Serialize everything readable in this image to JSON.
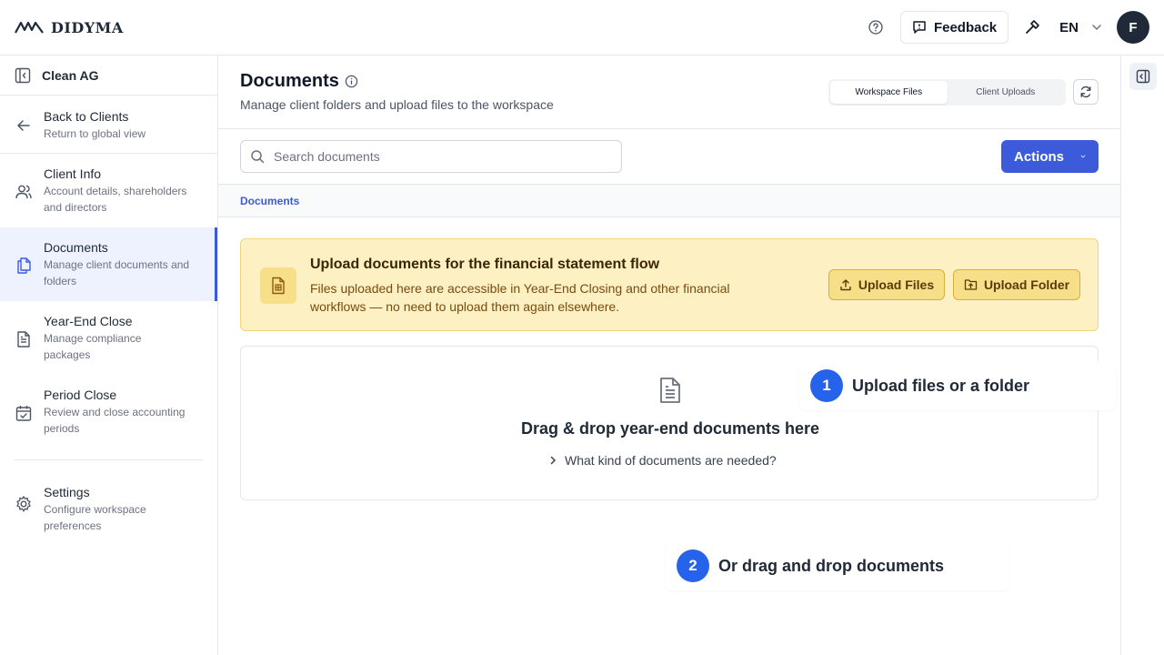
{
  "brand": {
    "name": "DIDYMA"
  },
  "header": {
    "feedback_label": "Feedback",
    "language": "EN",
    "avatar_initial": "F"
  },
  "sidebar": {
    "client_name": "Clean AG",
    "items": [
      {
        "title": "Back to Clients",
        "subtitle": "Return to global view"
      },
      {
        "title": "Client Info",
        "subtitle": "Account details, shareholders and directors"
      },
      {
        "title": "Documents",
        "subtitle": "Manage client documents and folders",
        "active": true
      },
      {
        "title": "Year-End Close",
        "subtitle": "Manage compliance packages"
      },
      {
        "title": "Period Close",
        "subtitle": "Review and close accounting periods"
      },
      {
        "title": "Settings",
        "subtitle": "Configure workspace preferences"
      }
    ]
  },
  "main": {
    "title": "Documents",
    "subtitle": "Manage client folders and upload files to the workspace",
    "tabs": [
      {
        "label": "Workspace Files",
        "active": true
      },
      {
        "label": "Client Uploads",
        "active": false
      }
    ],
    "search": {
      "placeholder": "Search documents",
      "value": ""
    },
    "actions_label": "Actions",
    "breadcrumb": "Documents",
    "banner": {
      "title": "Upload documents for the financial statement flow",
      "text": "Files uploaded here are accessible in Year-End Closing and other financial workflows — no need to upload them again elsewhere.",
      "upload_files_label": "Upload Files",
      "upload_folder_label": "Upload Folder"
    },
    "dropzone": {
      "title": "Drag & drop year-end documents here",
      "question": "What kind of documents are needed?"
    }
  },
  "callouts": [
    {
      "number": "1",
      "text": "Upload files or a folder"
    },
    {
      "number": "2",
      "text": "Or drag and drop documents"
    }
  ],
  "colors": {
    "accent": "#3b5bdb",
    "banner_bg": "#fdf1c4",
    "callout_badge": "#2563eb"
  }
}
